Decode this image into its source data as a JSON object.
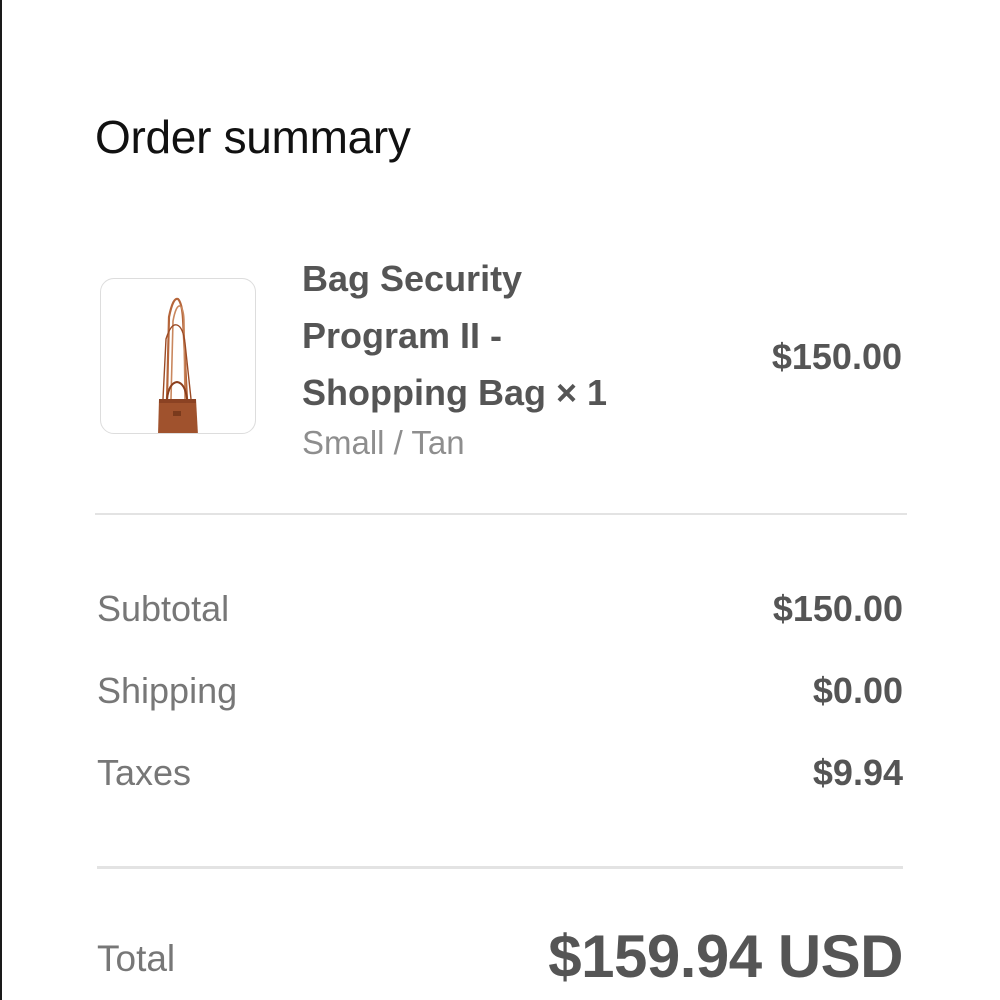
{
  "page": {
    "title": "Order summary"
  },
  "item": {
    "image_icon": "tote-bag-product-image",
    "name_line1": "Bag Security",
    "name_line2": "Program II -",
    "name_line3": "Shopping Bag × 1",
    "variant": "Small / Tan",
    "price": "$150.00"
  },
  "summary": {
    "rows": [
      {
        "label": "Subtotal",
        "value": "$150.00"
      },
      {
        "label": "Shipping",
        "value": "$0.00"
      },
      {
        "label": "Taxes",
        "value": "$9.94"
      }
    ]
  },
  "total": {
    "label": "Total",
    "value": "$159.94 USD"
  },
  "colors": {
    "text_primary": "#111111",
    "text_bold": "#555555",
    "text_muted": "#8e8e8e",
    "divider": "#e3e3e3",
    "bag_tan": "#a0522d"
  }
}
